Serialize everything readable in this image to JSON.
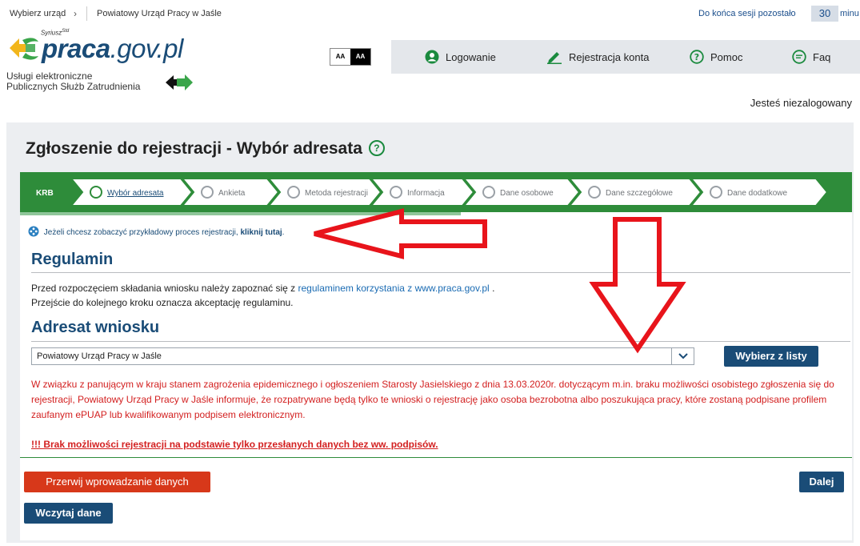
{
  "breadcrumb": {
    "home": "Wybierz urząd",
    "separator": "›",
    "current": "Powiatowy Urząd Pracy w Jaśle"
  },
  "session": {
    "label": "Do końca sesji pozostało",
    "minutes": "30",
    "unit": "minu"
  },
  "logo": {
    "small": "Syriusz",
    "small_sup": "Std",
    "main": "praca",
    "ext": ".gov.pl",
    "sub_line1": "Usługi elektroniczne",
    "sub_line2": "Publicznych Służb Zatrudnienia"
  },
  "font_size": {
    "small": "AA",
    "large": "AA"
  },
  "nav": {
    "login": "Logowanie",
    "register": "Rejestracja konta",
    "help": "Pomoc",
    "faq": "Faq"
  },
  "user_status": "Jesteś niezalogowany",
  "page_title": "Zgłoszenie do rejestracji - Wybór adresata",
  "help_icon_glyph": "?",
  "steps": {
    "first": "KRB",
    "items": [
      {
        "label": "Wybór adresata",
        "active": true
      },
      {
        "label": "Ankieta",
        "active": false
      },
      {
        "label": "Metoda rejestracji",
        "active": false
      },
      {
        "label": "Informacja",
        "active": false
      },
      {
        "label": "Dane osobowe",
        "active": false
      },
      {
        "label": "Dane szczegółowe",
        "active": false
      },
      {
        "label": "Dane dodatkowe",
        "active": false
      }
    ],
    "progress": 0.53
  },
  "info": {
    "text": "Jeżeli chcesz zobaczyć przykładowy proces rejestracji,",
    "link": "kliknij tutaj",
    "after": "."
  },
  "regulamin": {
    "heading": "Regulamin",
    "line1_before": "Przed rozpoczęciem składania wniosku należy zapoznać się z",
    "line1_link": "regulaminem korzystania z www.praca.gov.pl",
    "line1_after": ".",
    "line2": "Przejście do kolejnego kroku oznacza akceptację regulaminu."
  },
  "adresat": {
    "heading": "Adresat wniosku",
    "selected": "Powiatowy Urząd Pracy w Jaśle",
    "choose_button": "Wybierz z listy"
  },
  "warning": {
    "text": "W związku z panującym w kraju stanem zagrożenia epidemicznego i ogłoszeniem Starosty Jasielskiego z dnia 13.03.2020r. dotyczącym m.in. braku możliwości osobistego zgłoszenia się do rejestracji, Powiatowy Urząd Pracy w Jaśle informuje, że rozpatrywane będą tylko te wnioski o rejestrację jako osoba bezrobotna albo poszukująca pracy, które zostaną podpisane profilem zaufanym ePUAP lub kwalifikowanym podpisem elektronicznym.",
    "note": "!!! Brak możliwości rejestracji na podstawie tylko przesłanych danych bez ww. podpisów."
  },
  "buttons": {
    "cancel": "Przerwij wprowadzanie danych",
    "next": "Dalej",
    "load": "Wczytaj dane"
  },
  "colors": {
    "brand_blue": "#1a4c77",
    "step_green": "#2e8c3a",
    "warning_red": "#d32020",
    "cancel_red": "#d7381a",
    "annotation_red": "#e8141b"
  },
  "icons": {
    "nav_login": "user-circle-icon",
    "nav_register": "pencil-icon",
    "nav_help": "question-circle-icon",
    "nav_faq": "chat-bubble-icon",
    "info": "film-reel-icon",
    "select_toggle": "chevron-down-icon"
  }
}
